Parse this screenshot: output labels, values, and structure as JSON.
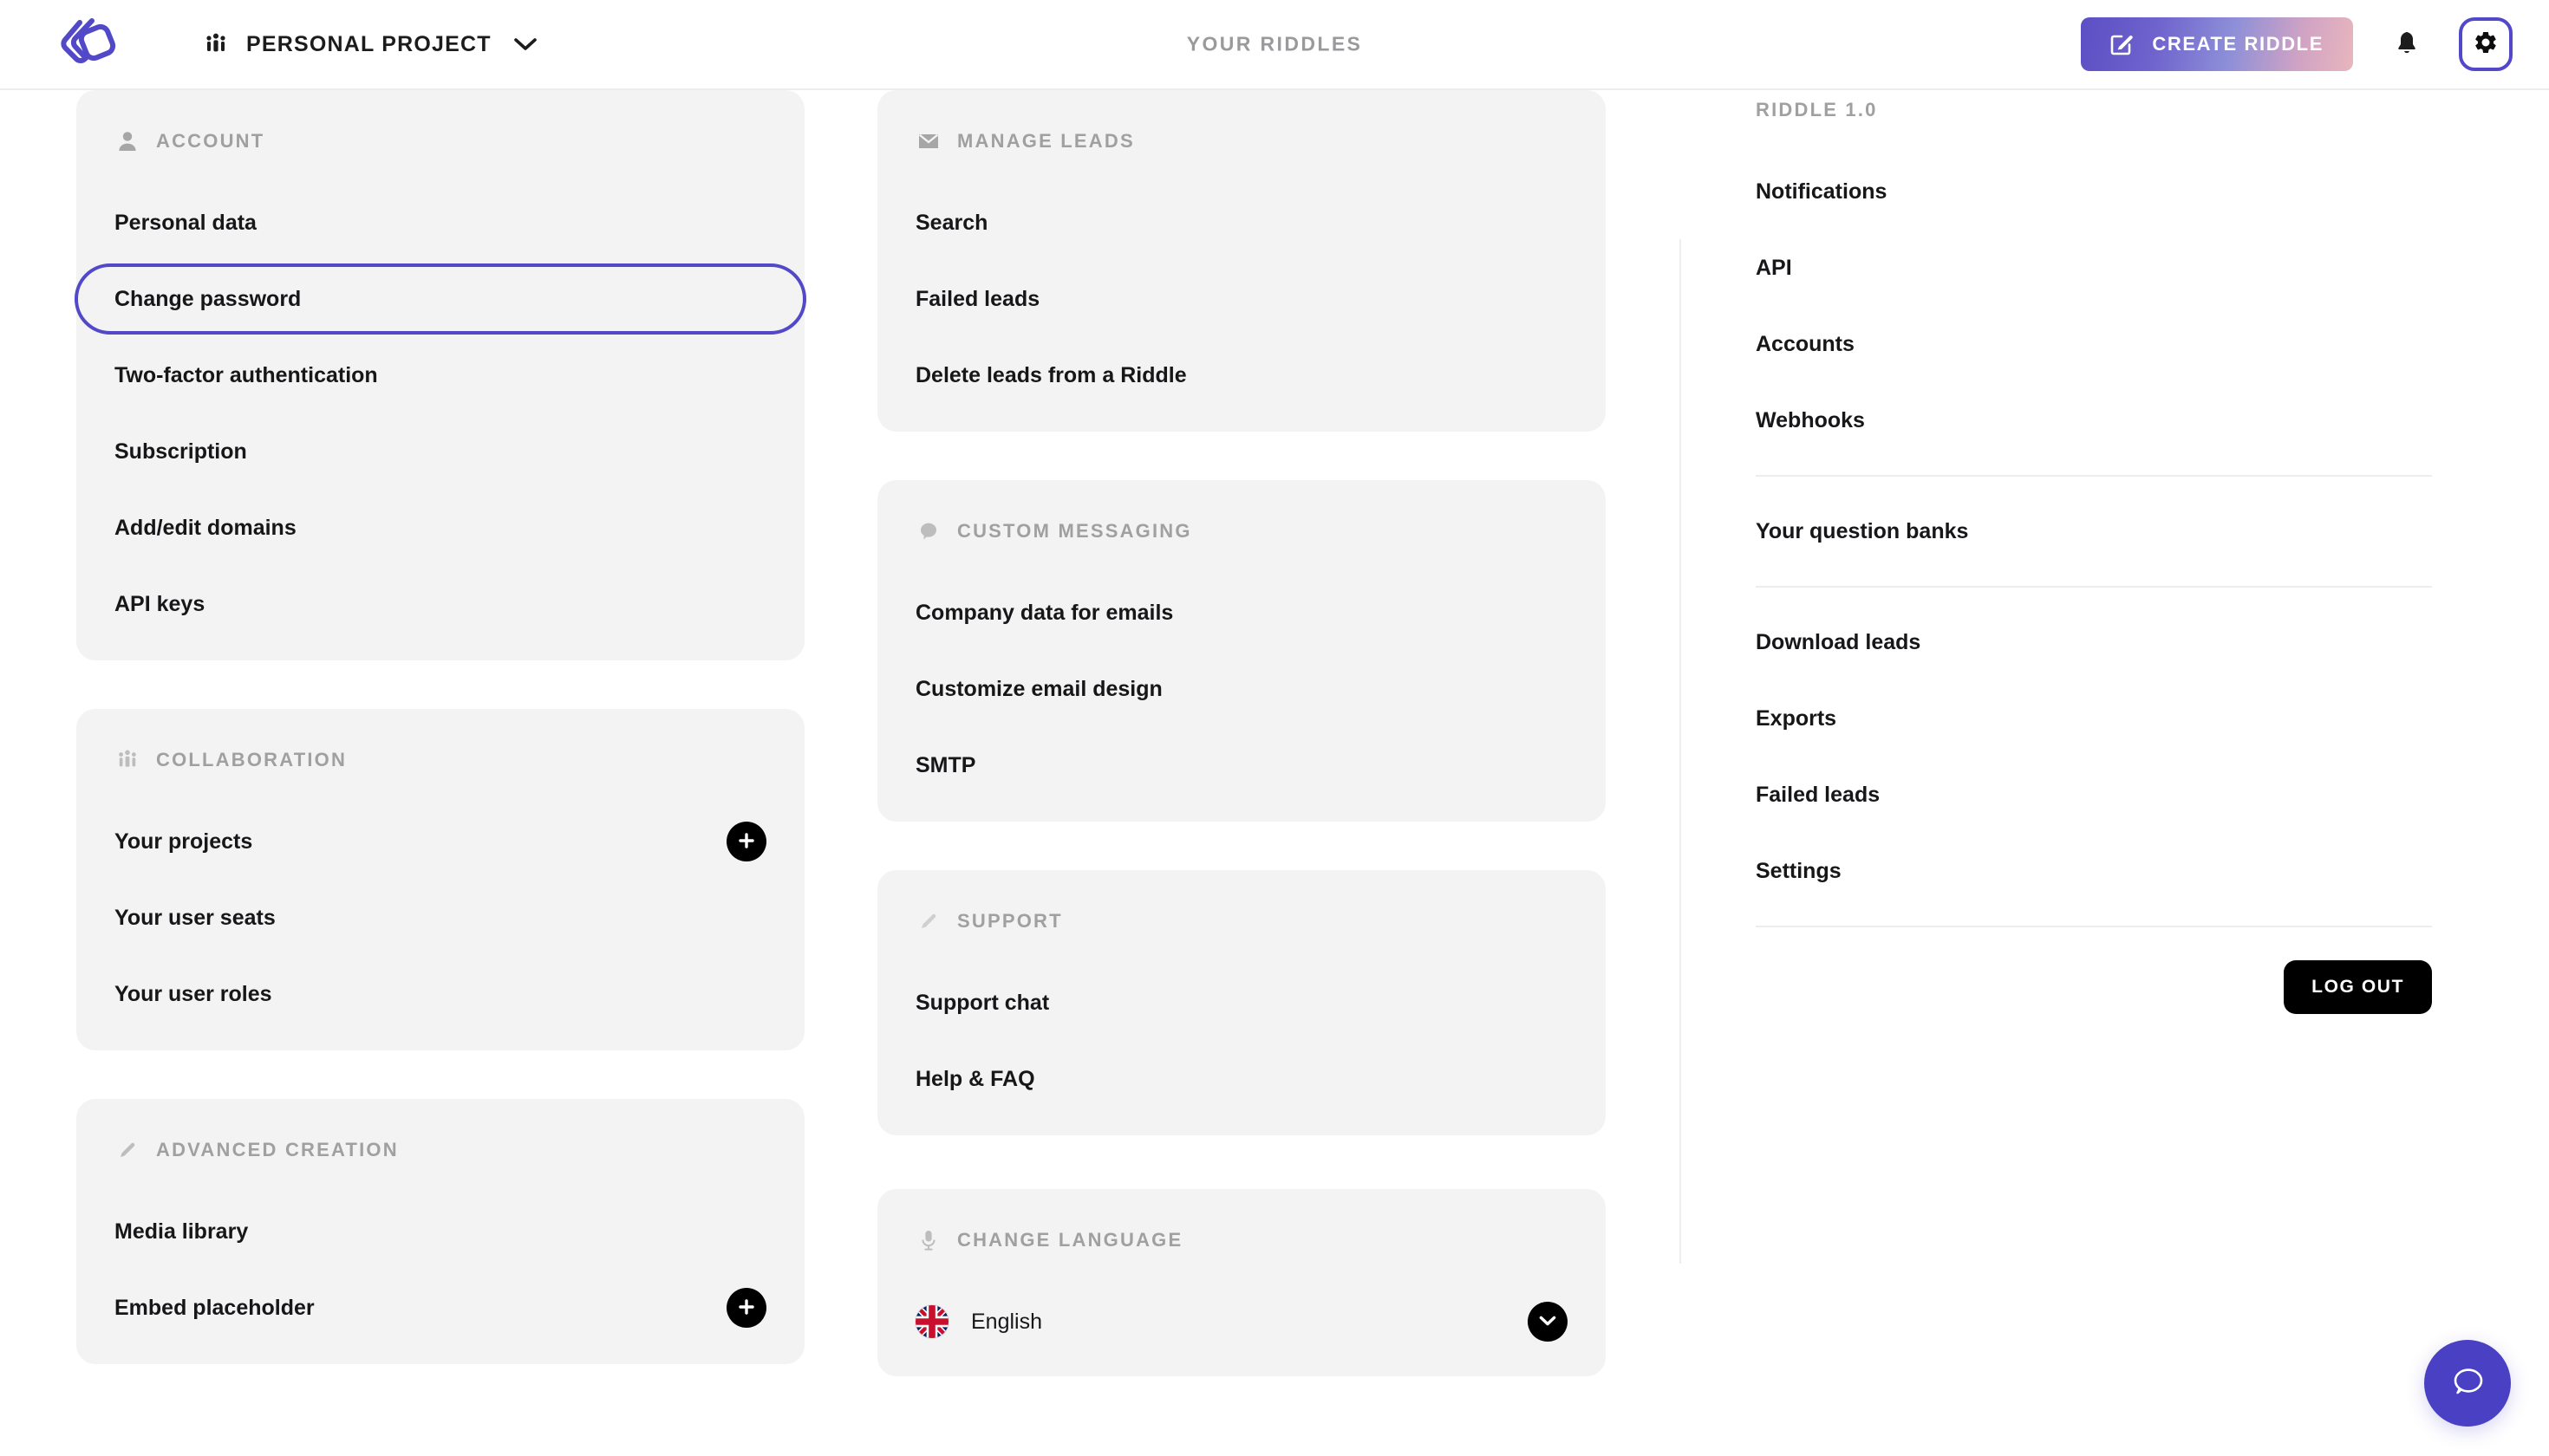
{
  "header": {
    "logo_alt": "riddle-logo",
    "project_name": "PERSONAL PROJECT",
    "page_title": "YOUR RIDDLES",
    "create_riddle_label": "CREATE RIDDLE",
    "accent_purple": "#5249c9",
    "gradient_from": "#5b4fc4",
    "gradient_to": "#e8b6bd"
  },
  "left_column": {
    "cards": [
      {
        "icon": "person-icon",
        "title": "ACCOUNT",
        "rows": [
          {
            "label": "Personal data",
            "highlight": false,
            "action": null
          },
          {
            "label": "Change password",
            "highlight": true,
            "action": null
          },
          {
            "label": "Two-factor authentication",
            "highlight": false,
            "action": null
          },
          {
            "label": "Subscription",
            "highlight": false,
            "action": null
          },
          {
            "label": "Add/edit domains",
            "highlight": false,
            "action": null
          },
          {
            "label": "API keys",
            "highlight": false,
            "action": null
          }
        ]
      },
      {
        "icon": "people-icon",
        "title": "COLLABORATION",
        "rows": [
          {
            "label": "Your projects",
            "highlight": false,
            "action": "plus"
          },
          {
            "label": "Your user seats",
            "highlight": false,
            "action": null
          },
          {
            "label": "Your user roles",
            "highlight": false,
            "action": null
          }
        ]
      },
      {
        "icon": "pencil-icon",
        "title": "ADVANCED CREATION",
        "rows": [
          {
            "label": "Media library",
            "highlight": false,
            "action": null
          },
          {
            "label": "Embed placeholder",
            "highlight": false,
            "action": "plus"
          }
        ]
      }
    ]
  },
  "middle_column": {
    "cards": [
      {
        "icon": "envelope-icon",
        "title": "MANAGE LEADS",
        "rows": [
          {
            "label": "Search",
            "highlight": false,
            "action": null
          },
          {
            "label": "Failed leads",
            "highlight": false,
            "action": null
          },
          {
            "label": "Delete leads from a Riddle",
            "highlight": false,
            "action": null
          }
        ]
      },
      {
        "icon": "speech-bubble-icon",
        "title": "CUSTOM MESSAGING",
        "rows": [
          {
            "label": "Company data for emails",
            "highlight": false,
            "action": null
          },
          {
            "label": "Customize email design",
            "highlight": false,
            "action": null
          },
          {
            "label": "SMTP",
            "highlight": false,
            "action": null
          }
        ]
      },
      {
        "icon": "pencil-icon",
        "title": "SUPPORT",
        "rows": [
          {
            "label": "Support chat",
            "highlight": false,
            "action": null
          },
          {
            "label": "Help & FAQ",
            "highlight": false,
            "action": null
          }
        ]
      }
    ],
    "language_card": {
      "icon": "microphone-icon",
      "title": "CHANGE LANGUAGE",
      "selected_language": "English",
      "flag": "uk-flag-icon",
      "action": "chevron-down"
    }
  },
  "right_column": {
    "title": "RIDDLE 1.0",
    "groups": [
      {
        "items": [
          {
            "label": "Notifications"
          },
          {
            "label": "API"
          },
          {
            "label": "Accounts"
          },
          {
            "label": "Webhooks"
          }
        ]
      },
      {
        "items": [
          {
            "label": "Your question banks"
          }
        ]
      },
      {
        "items": [
          {
            "label": "Download leads"
          },
          {
            "label": "Exports"
          },
          {
            "label": "Failed leads"
          },
          {
            "label": "Settings"
          }
        ]
      }
    ],
    "logout_label": "LOG OUT"
  },
  "chat_fab": {
    "icon": "chat-bubble-icon",
    "color": "#4a40c4"
  }
}
